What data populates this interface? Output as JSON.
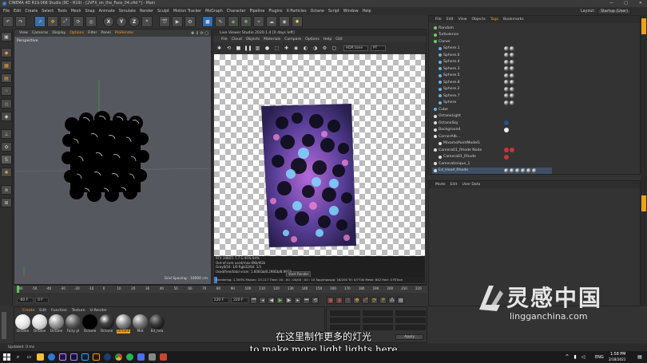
{
  "title_bar": {
    "text": "CINEMA 4D R19.068 Studio (RC - R19) - [2VFX_on_the_Face_04.c4d *] - Main"
  },
  "menu": [
    "File",
    "Edit",
    "Create",
    "Select",
    "Tools",
    "Mesh",
    "Snap",
    "Animate",
    "Simulate",
    "Render",
    "Sculpt",
    "Motion Tracker",
    "MoGraph",
    "Character",
    "Pipeline",
    "Plugins",
    "X-Particles",
    "Octane",
    "Script",
    "Window",
    "Help"
  ],
  "layout": {
    "label": "Layout:",
    "value": "Startup (User)"
  },
  "viewport": {
    "menu": [
      "View",
      "Cameras",
      "Display",
      "Options",
      "Filter",
      "Panel",
      "ProRender"
    ],
    "label": "Perspective",
    "grid_spacing": "Grid Spacing : 10000 cm"
  },
  "live_viewer": {
    "title": "Live Viewer Studio 2020.1.4 [0 days left]",
    "menu": [
      "File",
      "Cloud",
      "Objects",
      "Materials",
      "Compare",
      "Options",
      "Help",
      "GUI"
    ],
    "mode": "HDR tone",
    "mode2": "PT",
    "stats": [
      "RTX 2080Ti 7.7 G          95%         84%",
      "Out-of-core used/max:0Kb/4Gb",
      "Grey8/16: 1/0              Rgb32/64: 1/1",
      "Used/free/total vram: 1.606Gb/8.298Gb/8.96Gb"
    ],
    "start_button": "Start Render",
    "status": "Rendering: 1.355%   Ms/sec: 23.117   Time: 00 : 00 : 00/00 : 00 : 10   Spp/maxspp: 16/200   Tri: 0/774k   Mesh: 842   Hair: 0   RTXon"
  },
  "object_manager": {
    "menu": [
      "File",
      "Edit",
      "View",
      "Objects",
      "Tags",
      "Bookmarks"
    ],
    "objects": [
      "Random",
      "Turbulence",
      "Cloner",
      "Sphere.1",
      "Sphere.6",
      "Sphere.4",
      "Sphere.3",
      "Sphere.5",
      "Sphere.8",
      "Sphere.2",
      "Sphere.7",
      "Sphere",
      "Cube",
      "OctaneLight",
      "OctaneSky",
      "Background",
      "CornerAlb...",
      "MixamoPointModel1",
      "Camera01_Rhode Node",
      "Camera01_Rhode",
      "CameraUnique_1",
      "Ed_Head_Rhode"
    ]
  },
  "attribute_manager": {
    "menu": [
      "Mode",
      "Edit",
      "User Data"
    ]
  },
  "timeline": {
    "ticks": [
      "-60",
      "-50",
      "-40",
      "-30",
      "-20",
      "-10",
      "0",
      "10",
      "20",
      "30",
      "40",
      "50",
      "60",
      "70",
      "80",
      "90",
      "100",
      "110",
      "120",
      "130",
      "140",
      "150",
      "160",
      "170",
      "180",
      "190",
      "200",
      "210",
      "220"
    ],
    "start": "-60 F",
    "current": "0 F",
    "end_a": "220 F",
    "end_b": "220 F",
    "frame_right": "0 F"
  },
  "material_manager": {
    "menu": [
      "Create",
      "Edit",
      "Function",
      "Texture",
      "U-Render"
    ],
    "materials": [
      "Octane",
      "Octane",
      "Octane",
      "Fairy pl",
      "Octane",
      "Octane",
      "Octane",
      "Mat",
      "Ed_hea"
    ]
  },
  "coords": {
    "apply": "Apply"
  },
  "status_bar": {
    "text": "Updated: 0 ms"
  },
  "subtitles": {
    "cn": "在这里制作更多的灯光",
    "en": "to make more light lights here"
  },
  "watermark": {
    "cn": "灵感中国",
    "url": "lingganchina.com"
  },
  "taskbar": {
    "lang": "ENG",
    "time": "1:58 PM",
    "date": "2/18/2021"
  },
  "colors": {
    "accent_orange": "#f0a020",
    "selection_blue": "#69b0e6",
    "viewport_bg": "#55595f"
  }
}
